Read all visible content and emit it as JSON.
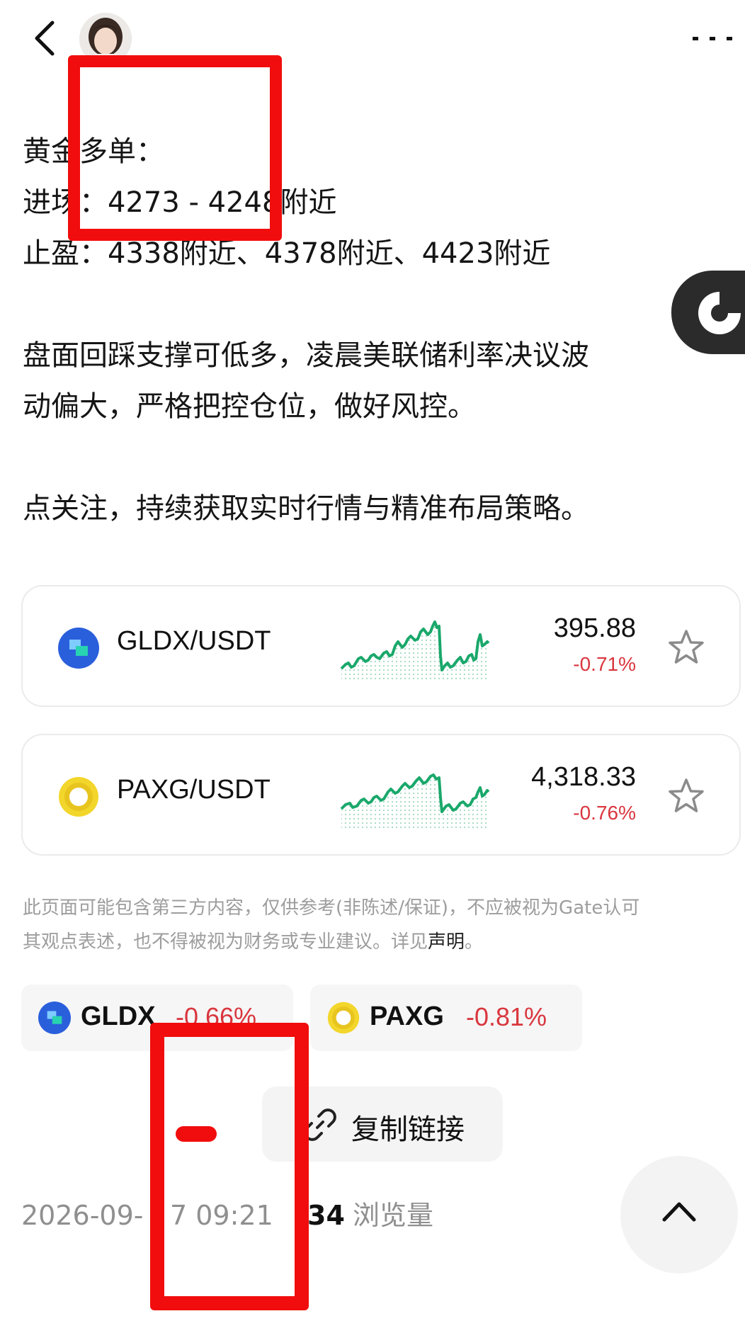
{
  "header": {
    "back_icon": "chevron-left-icon",
    "avatar_icon": "user-avatar",
    "more_icon": "more-horizontal-icon"
  },
  "post": {
    "line1": "黄金多单：",
    "line2": "进场：4273 - 4248附近",
    "line3": "止盈：4338附近、4378附近、4423附近",
    "para2_line1": "盘面回踩支撑可低多，凌晨美联储利率决议波",
    "para2_line2": "动偏大，严格把控仓位，做好风控。",
    "para3": "点关注，持续获取实时行情与精准布局策略。"
  },
  "floating_tab": {
    "icon": "refresh-icon",
    "color": "#2b2b2b"
  },
  "markets": [
    {
      "pair": "GLDX/USDT",
      "price": "395.88",
      "change": "-0.71%",
      "coin_icon": "gldx-coin-icon",
      "star_icon": "star-outline-icon"
    },
    {
      "pair": "PAXG/USDT",
      "price": "4,318.33",
      "change": "-0.76%",
      "coin_icon": "paxg-coin-icon",
      "star_icon": "star-outline-icon"
    }
  ],
  "disclaimer": {
    "text_line1": "此页面可能包含第三方内容，仅供参考(非陈述/保证)，不应被视为Gate认可",
    "text_line2": "其观点表述，也不得被视为财务或专业建议。详见",
    "link": "声明",
    "end": "。"
  },
  "tags": [
    {
      "symbol": "GLDX",
      "change": "-0.66%"
    },
    {
      "symbol": "PAXG",
      "change": "-0.81%"
    }
  ],
  "copy_link": {
    "label": "复制链接",
    "icon": "link-icon"
  },
  "meta": {
    "date": "2026-09-",
    "time": "7 09:21",
    "views_count": "34",
    "views_label": "浏览量"
  },
  "scroll_top_icon": "chevron-up-icon",
  "colors": {
    "negative": "#d9363e",
    "sparkline": "#1aa86b",
    "annotation_red": "#f10d0d"
  }
}
